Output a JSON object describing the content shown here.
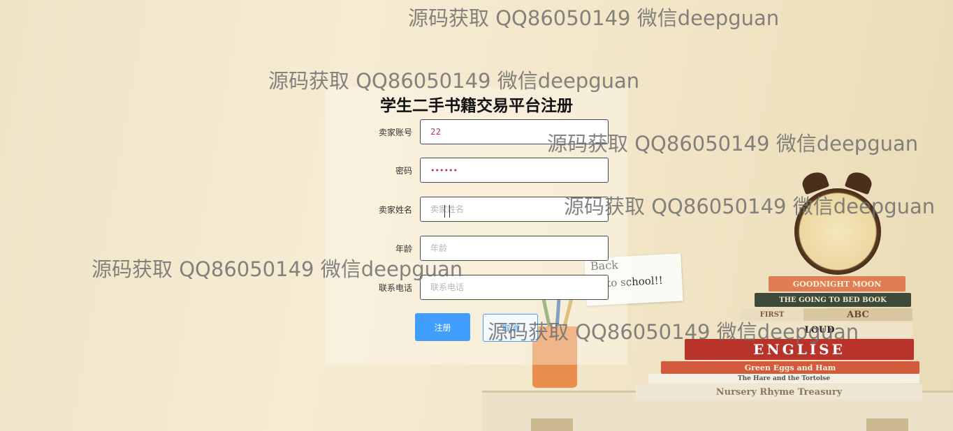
{
  "page": {
    "title": "学生二手书籍交易平台注册"
  },
  "form": {
    "account": {
      "label": "卖家账号",
      "value": "22",
      "placeholder": ""
    },
    "password": {
      "label": "密码",
      "value": "••••••",
      "placeholder": ""
    },
    "name": {
      "label": "卖家姓名",
      "value": "",
      "placeholder": "卖家姓名"
    },
    "age": {
      "label": "年龄",
      "value": "",
      "placeholder": "年龄"
    },
    "phone": {
      "label": "联系电话",
      "value": "",
      "placeholder": "联系电话"
    },
    "register_label": "注册",
    "cancel_label": "取消"
  },
  "watermark": {
    "text": "源码获取 QQ86050149 微信deepguan"
  },
  "decor": {
    "note_line1": "Back",
    "note_line2": "to school!!",
    "books": [
      "GOODNIGHT MOON",
      "THE GOING TO BED BOOK",
      "FIRST",
      "ABC",
      "LOUD",
      "ENGLISE",
      "Green Eggs and Ham",
      "The Hare and the Tortoise",
      "Nursery Rhyme Treasury"
    ],
    "colors": {
      "primary": "#409eff",
      "text_value": "#c0306b"
    }
  }
}
